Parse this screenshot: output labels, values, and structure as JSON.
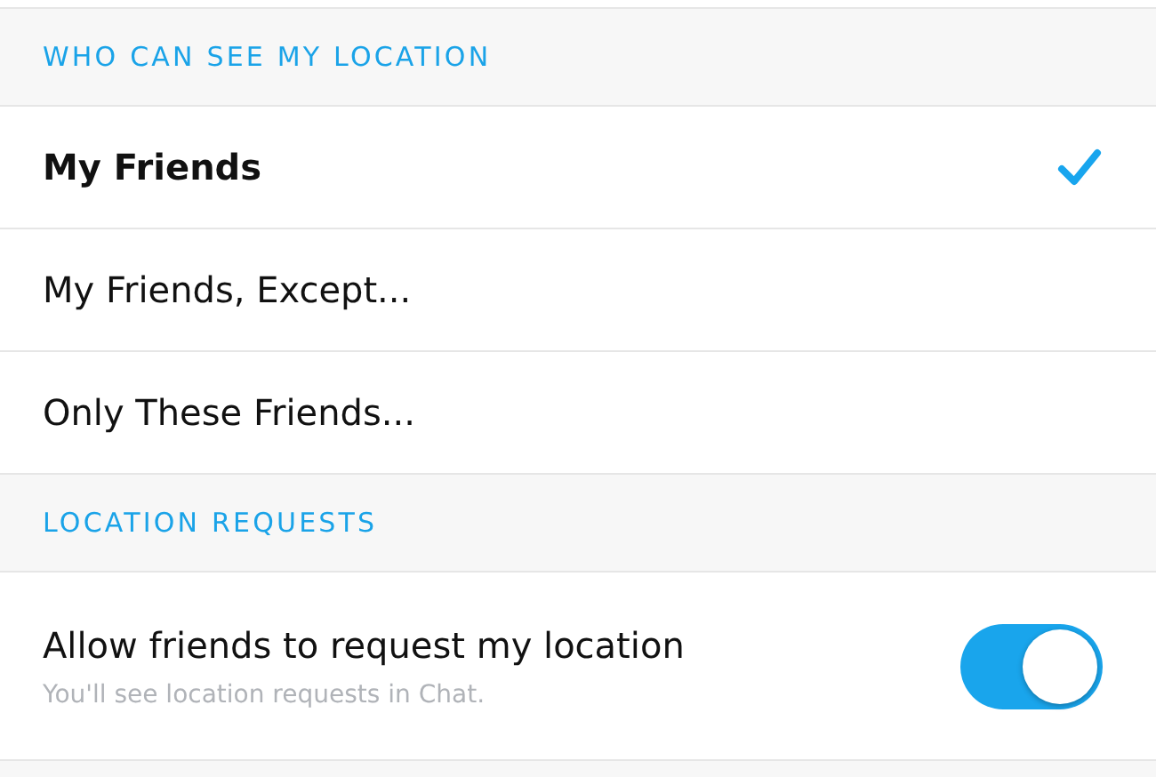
{
  "sections": [
    {
      "header": "WHO CAN SEE MY LOCATION",
      "kind": "options",
      "items": [
        {
          "label": "My Friends",
          "selected": true
        },
        {
          "label": "My Friends, Except...",
          "selected": false
        },
        {
          "label": "Only These Friends...",
          "selected": false
        }
      ]
    },
    {
      "header": "LOCATION REQUESTS",
      "kind": "toggles",
      "items": [
        {
          "label": "Allow friends to request my location",
          "description": "You'll see location requests in Chat.",
          "on": true
        }
      ]
    }
  ]
}
